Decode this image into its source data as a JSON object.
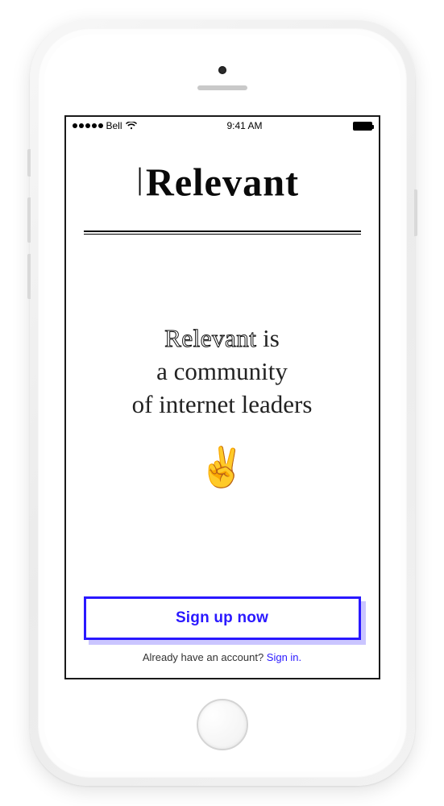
{
  "status_bar": {
    "carrier": "Bell",
    "time": "9:41 AM"
  },
  "logo": {
    "text": "Relevant"
  },
  "hero": {
    "brand": "Relevant",
    "rest_line1": " is",
    "line2": "a community",
    "line3": "of internet leaders",
    "emoji": "✌️"
  },
  "cta": {
    "label": "Sign up now"
  },
  "signin": {
    "prompt": "Already have an account? ",
    "link": "Sign in."
  },
  "colors": {
    "accent": "#2a18ff"
  }
}
